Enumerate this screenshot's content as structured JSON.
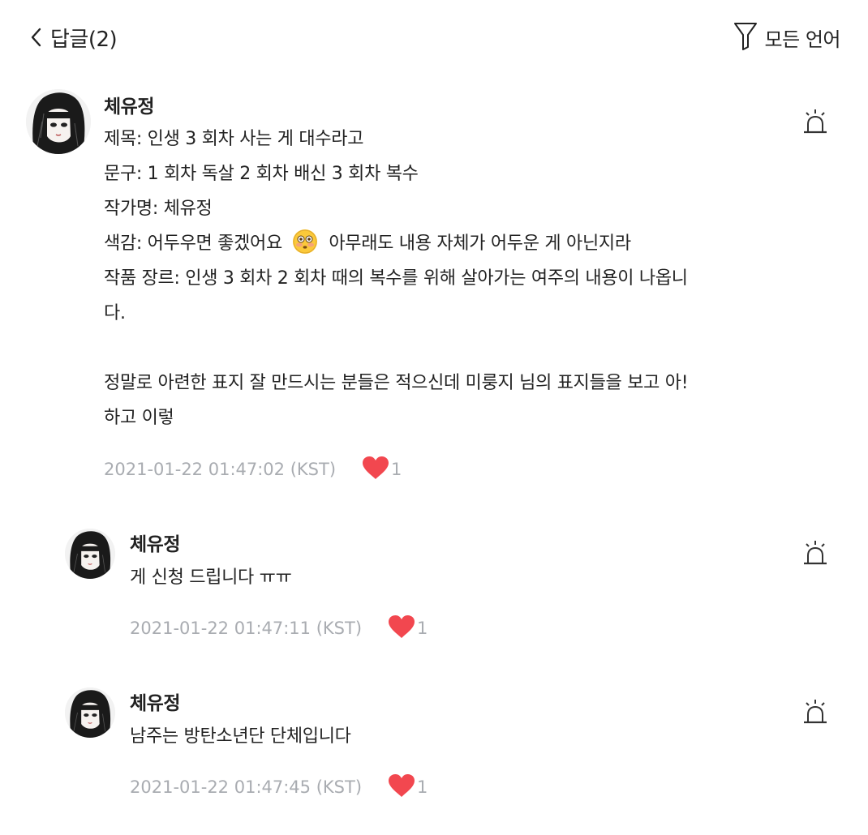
{
  "header": {
    "title": "답글(2)",
    "filter_label": "모든 언어"
  },
  "comments": [
    {
      "author": "체유정",
      "lines": [
        "제목: 인생 3 회차 사는 게 대수라고",
        "문구: 1 회차 독살 2 회차 배신 3 회차 복수",
        "작가명: 체유정",
        "",
        "작품 장르: 인생 3 회차 2 회차 때의 복수를 위해 살아가는 여주의 내용이 나옵니",
        "다.",
        "",
        "정말로 아련한 표지 잘 만드시는 분들은 적으신데 미룽지 님의 표지들을 보고 아!",
        "하고 이렇"
      ],
      "line4_before_emoji": "색감: 어두우면 좋겠어요",
      "line4_after_emoji": "아무래도 내용 자체가 어두운 게 아닌지라",
      "timestamp": "2021-01-22 01:47:02 (KST)",
      "likes": "1"
    },
    {
      "author": "체유정",
      "lines": [
        "게 신청 드립니다 ㅠㅠ"
      ],
      "timestamp": "2021-01-22 01:47:11 (KST)",
      "likes": "1"
    },
    {
      "author": "체유정",
      "lines": [
        "남주는 방탄소년단 단체입니다"
      ],
      "timestamp": "2021-01-22 01:47:45 (KST)",
      "likes": "1"
    }
  ],
  "colors": {
    "heart": "#f2474f",
    "meta_text": "#a9acb1",
    "text": "#222222"
  },
  "icons": {
    "back": "chevron-left-icon",
    "filter": "funnel-icon",
    "report": "siren-icon",
    "like": "heart-icon",
    "emoji": "flushed-face-emoji"
  }
}
